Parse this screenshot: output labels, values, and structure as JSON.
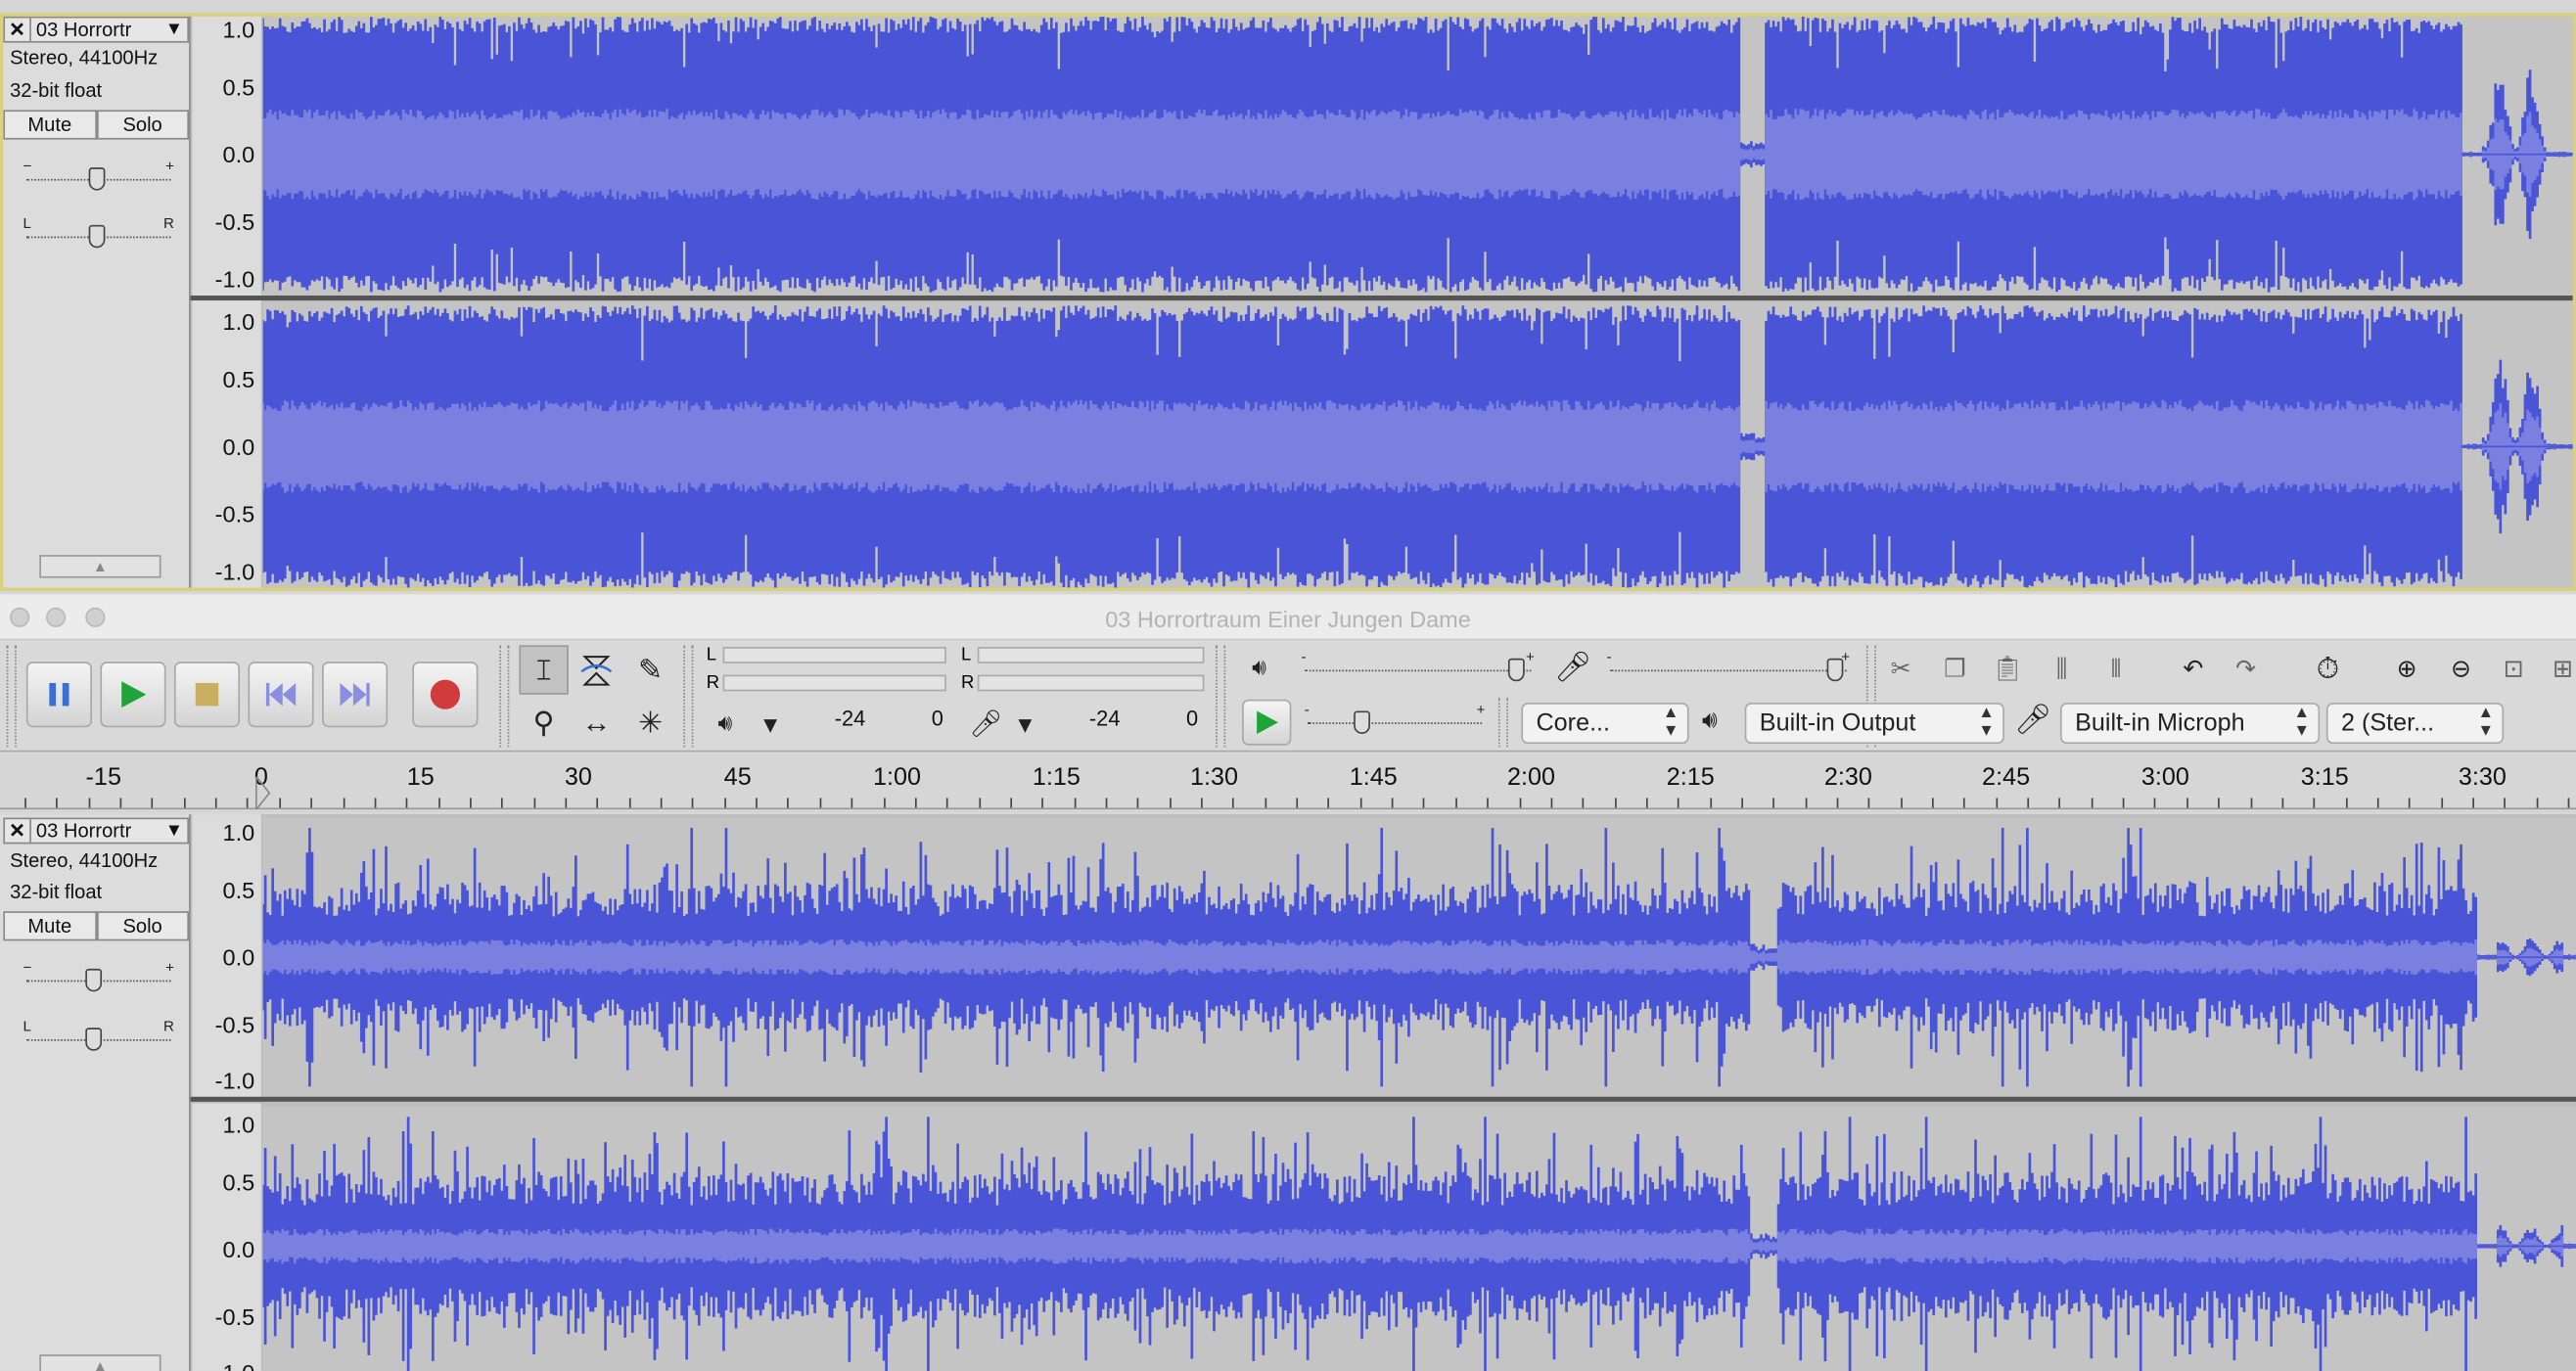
{
  "window": {
    "title": "03 Horrortraum Einer Jungen Dame"
  },
  "tracks": [
    {
      "name": "03 Horrortr",
      "info_line1": "Stereo, 44100Hz",
      "info_line2": "32-bit float",
      "mute_label": "Mute",
      "solo_label": "Solo",
      "gain_min": "−",
      "gain_max": "+",
      "pan_left": "L",
      "pan_right": "R"
    },
    {
      "name": "03 Horrortr",
      "info_line1": "Stereo, 44100Hz",
      "info_line2": "32-bit float",
      "mute_label": "Mute",
      "solo_label": "Solo",
      "gain_min": "−",
      "gain_max": "+",
      "pan_left": "L",
      "pan_right": "R"
    }
  ],
  "vruler_labels": [
    "1.0",
    "0.5",
    "0.0",
    "-0.5",
    "-1.0"
  ],
  "meters": {
    "playback_L": "L",
    "playback_R": "R",
    "record_L": "L",
    "record_R": "R",
    "db_minus24": "-24",
    "db_zero": "0"
  },
  "devices": {
    "host": "Core...",
    "output": "Built-in Output",
    "input": "Built-in Microph",
    "channels": "2 (Ster..."
  },
  "mixer": {
    "minus": "-",
    "plus": "+"
  },
  "timeline": {
    "labels": [
      "-15",
      "0",
      "15",
      "30",
      "45",
      "1:00",
      "1:15",
      "1:30",
      "1:45",
      "2:00",
      "2:15",
      "2:30",
      "2:45",
      "3:00",
      "3:15",
      "3:30"
    ]
  },
  "colors": {
    "waveform": "#4a54d6",
    "waveform_rms": "#7a80e0",
    "track_background": "#c4c4c4",
    "selected_border": "#d8d27a",
    "record_button": "#d23b3b",
    "play_button": "#1fa43a",
    "pause_button": "#3b6fd8"
  },
  "icons": {
    "pause": "pause-icon",
    "play": "play-icon",
    "stop": "stop-icon",
    "skip_start": "skip-to-start-icon",
    "skip_end": "skip-to-end-icon",
    "record": "record-icon",
    "selection_tool": "i-beam-icon",
    "envelope_tool": "envelope-icon",
    "draw_tool": "pencil-icon",
    "zoom_tool": "magnifier-icon",
    "timeshift_tool": "double-arrow-icon",
    "multi_tool": "asterisk-icon",
    "speaker": "speaker-icon",
    "microphone": "microphone-icon",
    "undo": "undo-icon",
    "redo": "redo-icon",
    "timer": "stopwatch-icon",
    "zoom_in": "zoom-in-icon",
    "zoom_out": "zoom-out-icon"
  }
}
